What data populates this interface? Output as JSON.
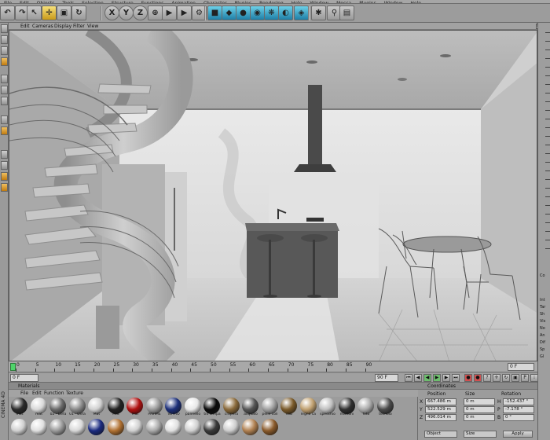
{
  "menu": [
    "File",
    "Edit",
    "Objects",
    "Tools",
    "Selection",
    "Structure",
    "Functions",
    "Animation",
    "Character",
    "Plugins",
    "Rendering",
    "Help",
    "Window",
    "Mocca",
    "Plugins",
    "Window",
    "Help"
  ],
  "toolbar": {
    "buttons": [
      {
        "name": "undo-icon",
        "glyph": "↶"
      },
      {
        "name": "redo-icon",
        "glyph": "↷"
      },
      {
        "name": "live-select-icon",
        "glyph": "↖"
      },
      {
        "name": "move-icon",
        "glyph": "✛"
      },
      {
        "name": "scale-icon",
        "glyph": "▣"
      },
      {
        "name": "rotate-icon",
        "glyph": "↻"
      },
      {
        "name": "x-axis-icon",
        "glyph": "X"
      },
      {
        "name": "y-axis-icon",
        "glyph": "Y"
      },
      {
        "name": "z-axis-icon",
        "glyph": "Z"
      },
      {
        "name": "coordinate-system-icon",
        "glyph": "⊕"
      },
      {
        "name": "render-view-icon",
        "glyph": "▶"
      },
      {
        "name": "render-picture-viewer-icon",
        "glyph": "▶"
      },
      {
        "name": "render-settings-icon",
        "glyph": "⚙"
      },
      {
        "name": "cube-icon",
        "glyph": "■"
      },
      {
        "name": "bend-icon",
        "glyph": "◆"
      },
      {
        "name": "nurbs-icon",
        "glyph": "●"
      },
      {
        "name": "array-icon",
        "glyph": "◉"
      },
      {
        "name": "deformer-icon",
        "glyph": "❋"
      },
      {
        "name": "scene-icon",
        "glyph": "◐"
      },
      {
        "name": "camera-icon",
        "glyph": "◈"
      },
      {
        "name": "light-icon",
        "glyph": "✱"
      },
      {
        "name": "hair-icon",
        "glyph": "⚲"
      },
      {
        "name": "layout-icon",
        "glyph": "▤"
      },
      {
        "name": "close-layout-icon",
        "glyph": "▣"
      }
    ]
  },
  "viewport": {
    "menu": [
      "Edit",
      "Cameras",
      "Display",
      "Filter",
      "View"
    ],
    "icons": [
      "✥",
      "↻",
      "⊕",
      "▢"
    ]
  },
  "timeline": {
    "labels": [
      "0",
      "5",
      "10",
      "15",
      "20",
      "25",
      "30",
      "35",
      "40",
      "45",
      "50",
      "55",
      "60",
      "65",
      "70",
      "75",
      "80",
      "85",
      "90"
    ],
    "end_field": "0 F"
  },
  "transport": {
    "start_field": "0 F",
    "frame_field": "90 F",
    "end_field": "0 F"
  },
  "materials": {
    "title": "Materials",
    "menu": [
      "File",
      "Edit",
      "Function",
      "Texture"
    ],
    "row1": [
      {
        "label": "mat",
        "color": "#2a2a2a"
      },
      {
        "label": "mat",
        "color": "#d8d8d8"
      },
      {
        "label": "02 - Defa",
        "color": "#6a6a6a"
      },
      {
        "label": "01 - Defa",
        "color": "#8a8a8a"
      },
      {
        "label": "Mat",
        "color": "#d0d0d0"
      },
      {
        "label": "Mat",
        "color": "#222222"
      },
      {
        "label": "Mat",
        "color": "#b01010"
      },
      {
        "label": "PAVIME",
        "color": "#9a9a9a"
      },
      {
        "label": "VETRO",
        "color": "#1c2f7a"
      },
      {
        "label": "pannello",
        "color": "#e8e8e8"
      },
      {
        "label": "tid lampa",
        "color": "#0a0a0a"
      },
      {
        "label": "cropera",
        "color": "#8a6a3a"
      },
      {
        "label": "acqualo",
        "color": "#555555"
      },
      {
        "label": "pelle coll",
        "color": "#a0a0a0"
      },
      {
        "label": "cob",
        "color": "#7a5a2a"
      },
      {
        "label": "legno ca",
        "color": "#c0a070"
      },
      {
        "label": "specchio",
        "color": "#bfbfbf"
      },
      {
        "label": "mattoni",
        "color": "#303030"
      },
      {
        "label": "foto",
        "color": "#aaaaaa"
      },
      {
        "label": "tecnolo",
        "color": "#4a4a4a"
      }
    ],
    "row2": [
      {
        "label": "",
        "color": "#d0d0d0"
      },
      {
        "label": "",
        "color": "#e0e0e0"
      },
      {
        "label": "",
        "color": "#9a9a9a"
      },
      {
        "label": "",
        "color": "#d8d8d8"
      },
      {
        "label": "",
        "color": "#1a2a80"
      },
      {
        "label": "",
        "color": "#b07030"
      },
      {
        "label": "",
        "color": "#d0d0d0"
      },
      {
        "label": "",
        "color": "#aaaaaa"
      },
      {
        "label": "",
        "color": "#e0e0e0"
      },
      {
        "label": "",
        "color": "#d0d0d0"
      },
      {
        "label": "",
        "color": "#3a3a3a"
      },
      {
        "label": "",
        "color": "#cccccc"
      },
      {
        "label": "",
        "color": "#b08050"
      },
      {
        "label": "",
        "color": "#8a5a2a"
      }
    ]
  },
  "coordinates": {
    "title": "Coordinates",
    "headers": {
      "position": "Position",
      "size": "Size",
      "rotation": "Rotation"
    },
    "rows": [
      {
        "axis": "X",
        "position": "667.486 m",
        "size": "0 m",
        "rot_axis": "H",
        "rotation": "-152.437 °"
      },
      {
        "axis": "Y",
        "position": "522.529 m",
        "size": "0 m",
        "rot_axis": "P",
        "rotation": "-7.178 °"
      },
      {
        "axis": "Z",
        "position": "496.014 m",
        "size": "0 m",
        "rot_axis": "B",
        "rotation": "0 °"
      }
    ],
    "mode_select": "Object",
    "size_select": "Size",
    "apply": "Apply"
  },
  "right_panel": {
    "lines": [
      "Co",
      "Int",
      "Tar",
      "Sh",
      "Vis",
      "No",
      "An",
      "Dif",
      "Sp",
      "Gl"
    ]
  },
  "brand": "CINEMA 4D"
}
